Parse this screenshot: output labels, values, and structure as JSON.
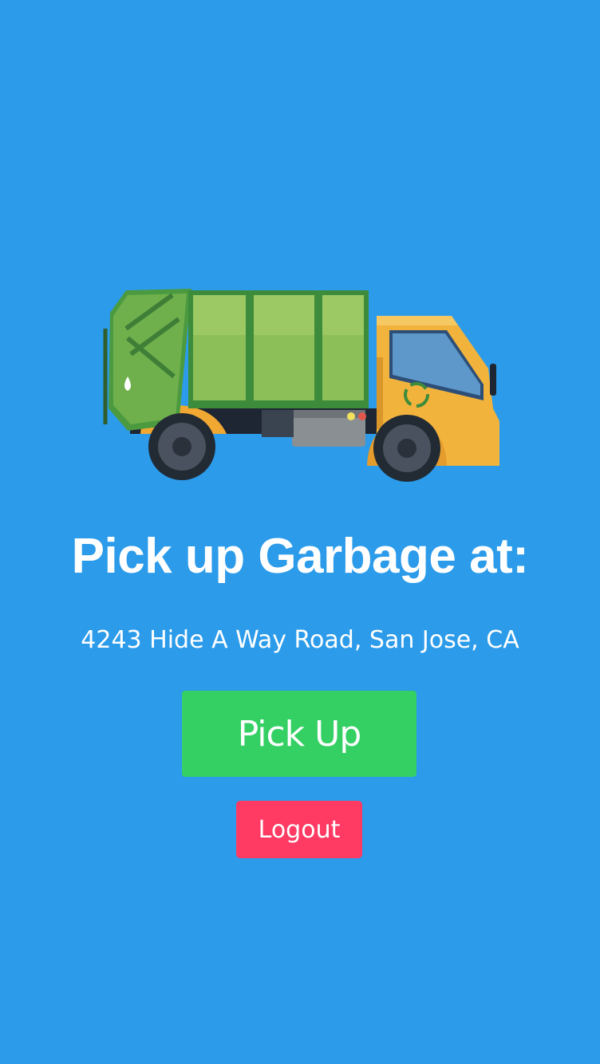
{
  "colors": {
    "background": "#2B9BEA",
    "primary_button": "#34D064",
    "danger_button": "#FF3A63",
    "text": "#FFFFFF"
  },
  "hero": {
    "icon": "garbage-truck-icon"
  },
  "title": "Pick up Garbage at:",
  "address": "4243 Hide A Way Road, San Jose, CA",
  "buttons": {
    "pickup_label": "Pick Up",
    "logout_label": "Logout"
  }
}
